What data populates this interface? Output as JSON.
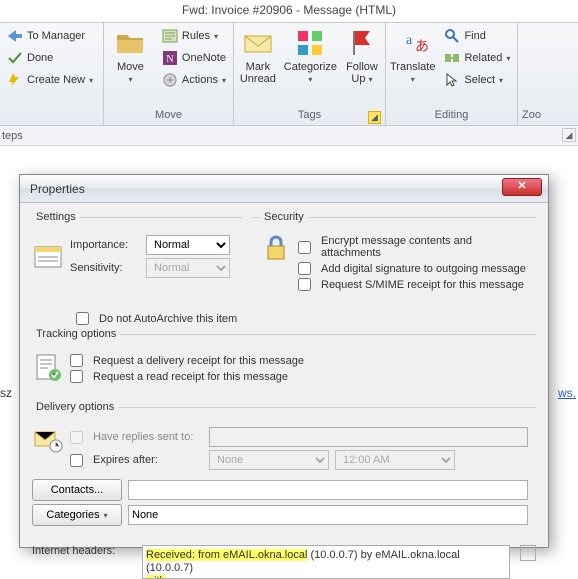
{
  "title": "Fwd: Invoice #20906  -  Message (HTML)",
  "ribbon": {
    "quick": {
      "to_manager": "To Manager",
      "done": "Done",
      "create_new": "Create New"
    },
    "move": {
      "btn": "Move",
      "rules": "Rules",
      "onenote": "OneNote",
      "actions": "Actions",
      "label": "Move"
    },
    "tags": {
      "mark_unread_1": "Mark",
      "mark_unread_2": "Unread",
      "categorize": "Categorize",
      "follow_up_1": "Follow",
      "follow_up_2": "Up",
      "label": "Tags"
    },
    "editing": {
      "translate": "Translate",
      "find": "Find",
      "related": "Related",
      "select": "Select",
      "label": "Editing"
    },
    "zoom": {
      "label": "Zoo"
    }
  },
  "steps_label": "teps",
  "background": {
    "left_fragment": "sz",
    "right_fragment": "ws."
  },
  "dialog": {
    "title": "Properties",
    "settings": {
      "legend": "Settings",
      "importance_label": "Importance:",
      "importance_value": "Normal",
      "sensitivity_label": "Sensitivity:",
      "sensitivity_value": "Normal",
      "autoarchive": "Do not AutoArchive this item"
    },
    "security": {
      "legend": "Security",
      "encrypt": "Encrypt message contents and attachments",
      "sign": "Add digital signature to outgoing message",
      "smime": "Request S/MIME receipt for this message"
    },
    "tracking": {
      "legend": "Tracking options",
      "delivery": "Request a delivery receipt for this message",
      "read": "Request a read receipt for this message"
    },
    "delivery": {
      "legend": "Delivery options",
      "replies_label": "Have replies sent to:",
      "expires_label": "Expires after:",
      "expires_date": "None",
      "expires_time": "12:00 AM",
      "contacts_btn": "Contacts...",
      "categories_btn": "Categories",
      "categories_value": "None"
    },
    "headers": {
      "label": "Internet headers:",
      "hl1": "Received: from eMAIL.okna.local",
      "plain1": " (10.0.0.7) by eMAIL.okna.local (10.0.0.7)",
      "hl2": "with"
    }
  }
}
